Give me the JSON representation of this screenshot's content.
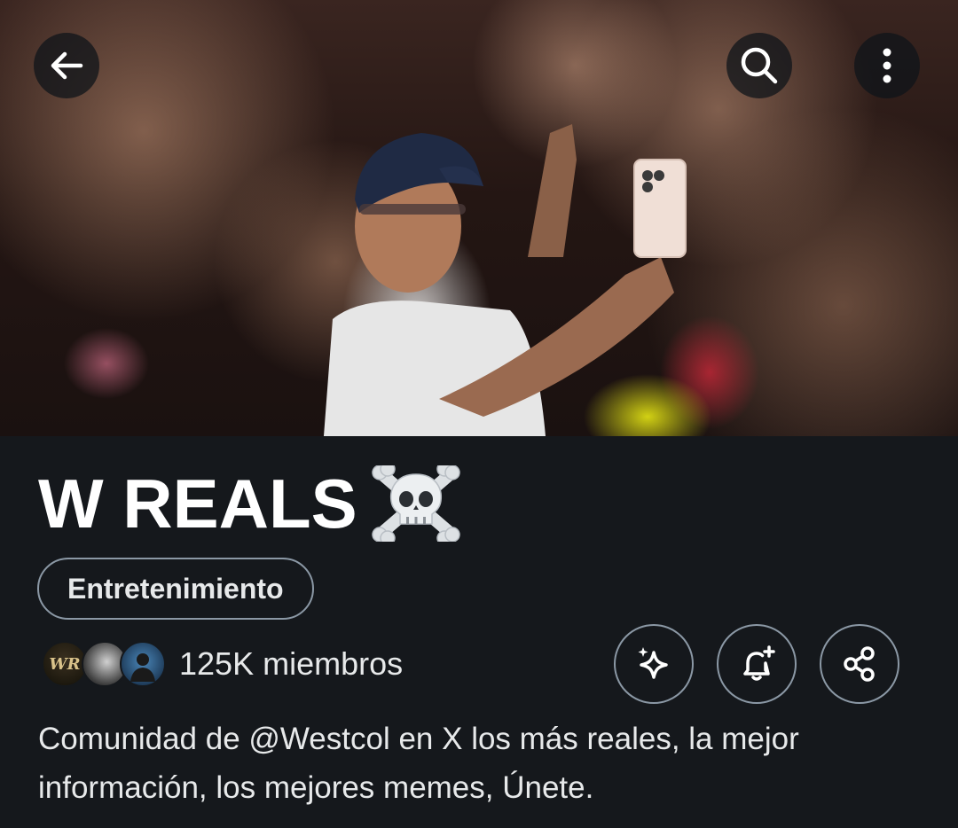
{
  "header": {
    "back_icon": "arrow-left-icon",
    "search_icon": "search-icon",
    "more_icon": "more-vertical-icon"
  },
  "banner": {
    "description_icon": "banner-photo"
  },
  "community": {
    "name": "W REALS",
    "name_emoji": "skull-and-crossbones-icon",
    "category": "Entretenimiento",
    "members_count": "125K miembros",
    "avatar_badge_text": "WR",
    "description": "Comunidad de @Westcol en X los más reales, la mejor información, los mejores memes, Únete."
  },
  "actions": {
    "sparkle_icon": "sparkle-icon",
    "bell_icon": "bell-plus-icon",
    "share_icon": "share-icon"
  },
  "colors": {
    "background": "#15181c",
    "text_primary": "#e7e9ea",
    "border": "#8b98a5",
    "title": "#ffffff"
  }
}
